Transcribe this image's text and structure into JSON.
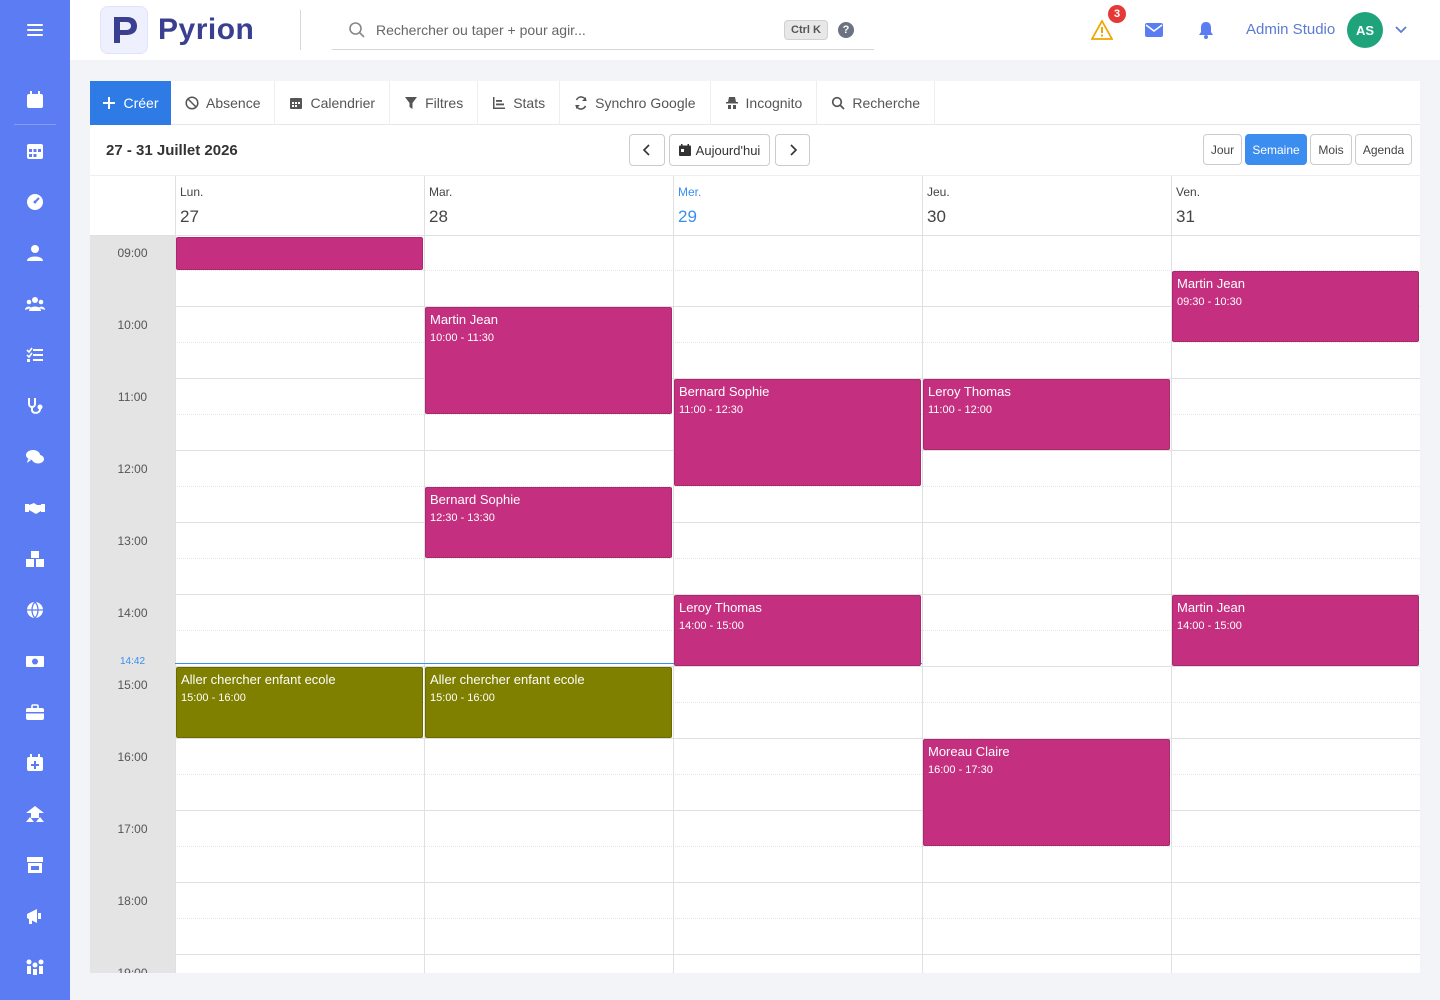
{
  "app": {
    "name": "Pyrion"
  },
  "search": {
    "placeholder": "Rechercher ou taper + pour agir...",
    "shortcut": "Ctrl K",
    "help": "?"
  },
  "header": {
    "alert_count": "3",
    "user_name": "Admin Studio",
    "avatar_initials": "AS"
  },
  "sidebar": {
    "items": [
      {
        "icon": "menu-icon"
      },
      {
        "icon": "calendar-icon"
      },
      {
        "icon": "calendar-grid-icon"
      },
      {
        "icon": "dashboard-gauge-icon"
      },
      {
        "icon": "user-icon"
      },
      {
        "icon": "users-icon"
      },
      {
        "icon": "task-list-icon"
      },
      {
        "icon": "stethoscope-icon"
      },
      {
        "icon": "chat-icon"
      },
      {
        "icon": "handshake-icon"
      },
      {
        "icon": "boxes-icon"
      },
      {
        "icon": "globe-icon"
      },
      {
        "icon": "money-icon"
      },
      {
        "icon": "briefcase-icon"
      },
      {
        "icon": "calendar-plus-icon"
      },
      {
        "icon": "hands-house-icon"
      },
      {
        "icon": "store-icon"
      },
      {
        "icon": "megaphone-icon"
      },
      {
        "icon": "people-group-icon"
      }
    ]
  },
  "toolbar": {
    "create": "Créer",
    "absence": "Absence",
    "calendar": "Calendrier",
    "filters": "Filtres",
    "stats": "Stats",
    "google_sync": "Synchro Google",
    "incognito": "Incognito",
    "search": "Recherche"
  },
  "calendar": {
    "range_title": "27 - 31 Juillet 2026",
    "today_label": "Aujourd'hui",
    "views": {
      "day": "Jour",
      "week": "Semaine",
      "month": "Mois",
      "agenda": "Agenda",
      "active": "week"
    },
    "days": [
      {
        "name": "Lun.",
        "num": "27",
        "today": false
      },
      {
        "name": "Mar.",
        "num": "28",
        "today": false
      },
      {
        "name": "Mer.",
        "num": "29",
        "today": true
      },
      {
        "name": "Jeu.",
        "num": "30",
        "today": false
      },
      {
        "name": "Ven.",
        "num": "31",
        "today": false
      }
    ],
    "hours": [
      "09:00",
      "10:00",
      "11:00",
      "12:00",
      "13:00",
      "14:00",
      "15:00",
      "16:00",
      "17:00",
      "18:00",
      "19:00"
    ],
    "now_label": "14:42",
    "events": [
      {
        "day": 0,
        "start": "08:45",
        "end": "09:30",
        "title": "",
        "time": "",
        "kind": "appt"
      },
      {
        "day": 4,
        "start": "09:30",
        "end": "10:30",
        "title": "Martin Jean",
        "time": "09:30 - 10:30",
        "kind": "appt"
      },
      {
        "day": 1,
        "start": "10:00",
        "end": "11:30",
        "title": "Martin Jean",
        "time": "10:00 - 11:30",
        "kind": "appt"
      },
      {
        "day": 2,
        "start": "11:00",
        "end": "12:30",
        "title": "Bernard Sophie",
        "time": "11:00 - 12:30",
        "kind": "appt"
      },
      {
        "day": 3,
        "start": "11:00",
        "end": "12:00",
        "title": "Leroy Thomas",
        "time": "11:00 - 12:00",
        "kind": "appt"
      },
      {
        "day": 1,
        "start": "12:30",
        "end": "13:30",
        "title": "Bernard Sophie",
        "time": "12:30 - 13:30",
        "kind": "appt"
      },
      {
        "day": 2,
        "start": "14:00",
        "end": "15:00",
        "title": "Leroy Thomas",
        "time": "14:00 - 15:00",
        "kind": "appt"
      },
      {
        "day": 4,
        "start": "14:00",
        "end": "15:00",
        "title": "Martin Jean",
        "time": "14:00 - 15:00",
        "kind": "appt"
      },
      {
        "day": 0,
        "start": "15:00",
        "end": "16:00",
        "title": "Aller chercher enfant ecole",
        "time": "15:00 - 16:00",
        "kind": "perso"
      },
      {
        "day": 1,
        "start": "15:00",
        "end": "16:00",
        "title": "Aller chercher enfant ecole",
        "time": "15:00 - 16:00",
        "kind": "perso"
      },
      {
        "day": 3,
        "start": "16:00",
        "end": "17:30",
        "title": "Moreau Claire",
        "time": "16:00 - 17:30",
        "kind": "appt"
      }
    ]
  },
  "colors": {
    "sidebar": "#5c7cf3",
    "primary": "#2e7be6",
    "appointment": "#c4307f",
    "personal": "#7f7f00",
    "today": "#3b8ef0"
  }
}
